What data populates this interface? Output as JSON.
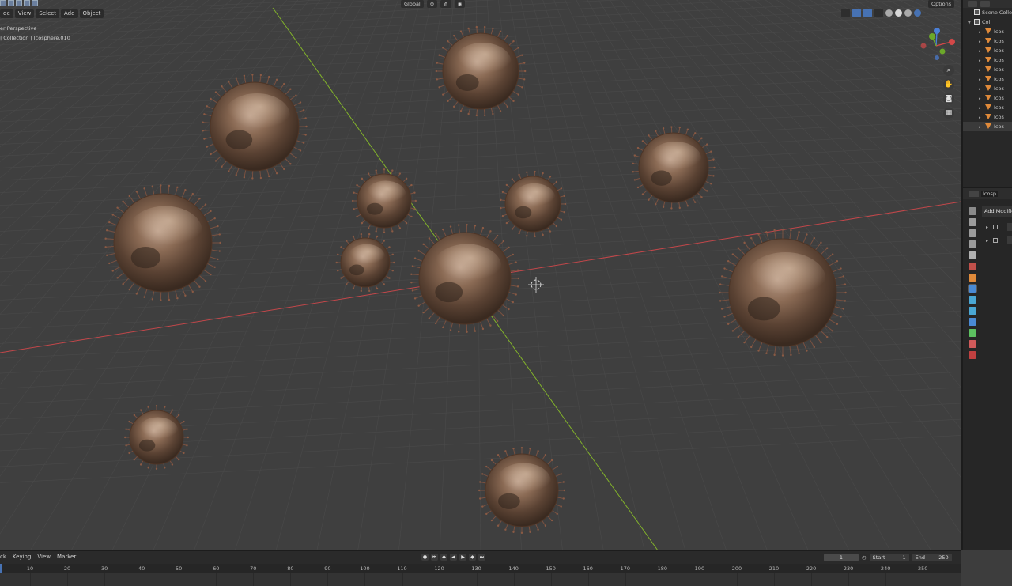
{
  "viewport": {
    "menu": [
      "de",
      "View",
      "Select",
      "Add",
      "Object"
    ],
    "overlay_line1": "er Perspective",
    "overlay_line2": "| Collection | Icosphere.010",
    "transform_orientation": "Global",
    "options_label": "Options"
  },
  "outliner": {
    "scene_collection": "Scene Colle",
    "collection": "Coll",
    "items": [
      "Icos",
      "Icos",
      "Icos",
      "Icos",
      "Icos",
      "Icos",
      "Icos",
      "Icos",
      "Icos",
      "Icos",
      "Icos"
    ]
  },
  "properties": {
    "object_name": "Icosp",
    "add_modifier": "Add Modifie"
  },
  "timeline": {
    "menu": [
      "ck",
      "Keying",
      "View",
      "Marker"
    ],
    "current_frame": "1",
    "start_label": "Start",
    "start_value": "1",
    "end_label": "End",
    "end_value": "250",
    "ruler_ticks": [
      "10",
      "20",
      "30",
      "40",
      "50",
      "60",
      "70",
      "80",
      "90",
      "100",
      "110",
      "120",
      "130",
      "140",
      "150",
      "160",
      "170",
      "180",
      "190",
      "200",
      "210",
      "220",
      "230",
      "240",
      "250"
    ]
  },
  "colors": {
    "viewport_bg": "#3f3f3f",
    "x_axis": "#c2474a",
    "y_axis": "#82b32a",
    "accent": "#4772b3"
  }
}
